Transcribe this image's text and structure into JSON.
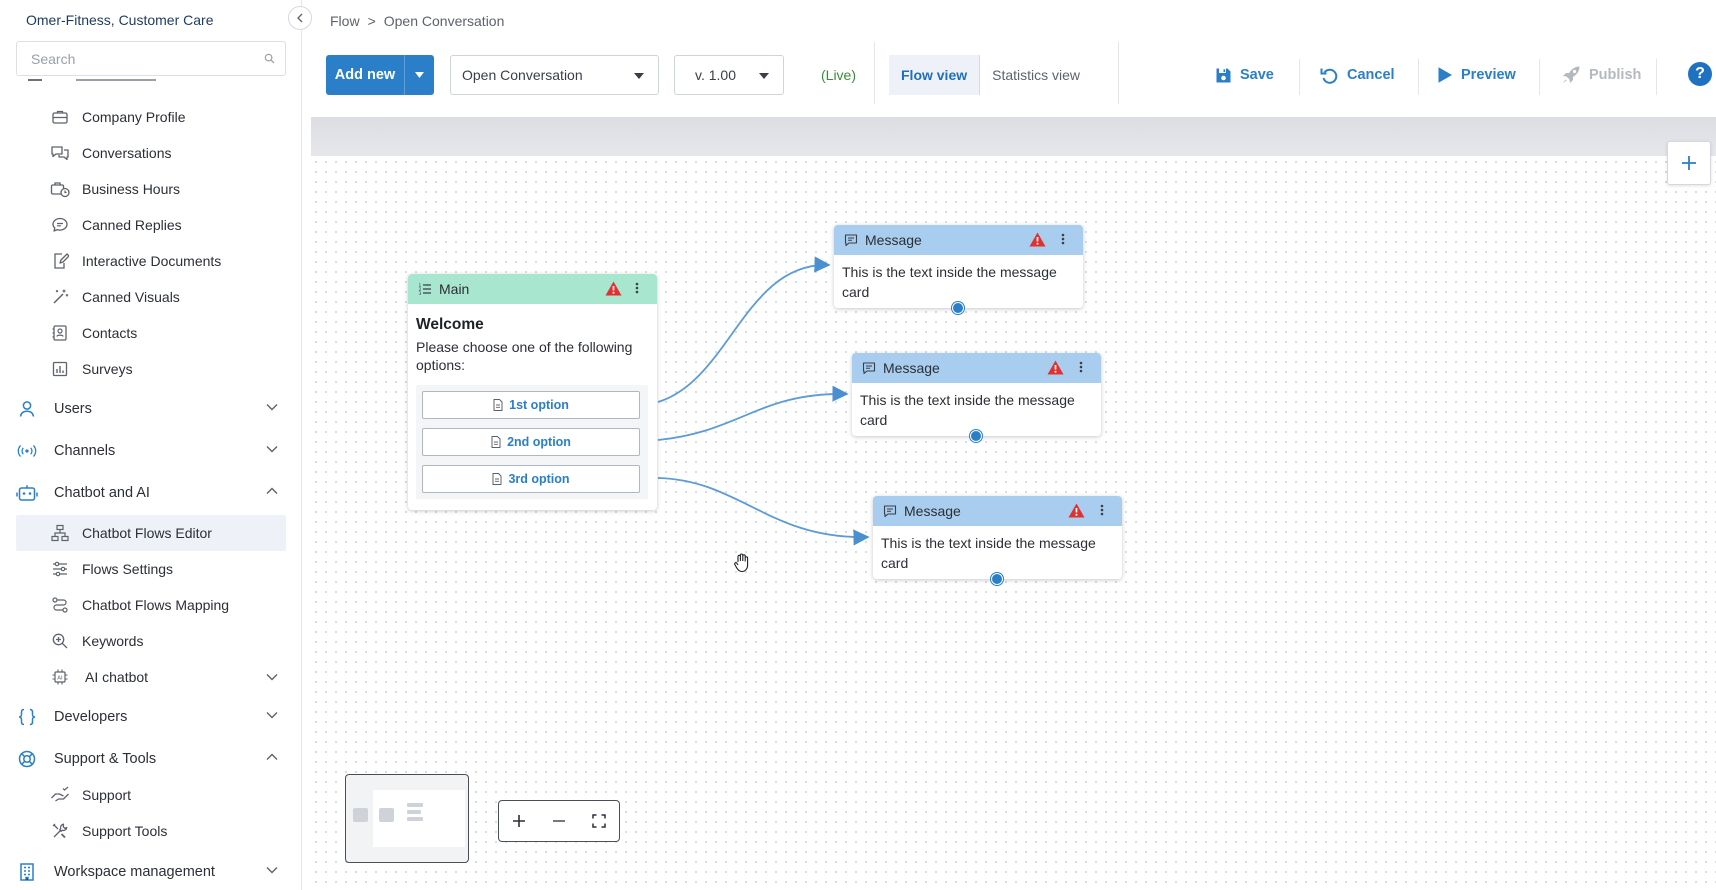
{
  "org_name": "Omer-Fitness, Customer Care",
  "search": {
    "placeholder": "Search"
  },
  "sidebar": {
    "top_items": [
      {
        "label": "Company Profile",
        "icon": "briefcase-icon"
      },
      {
        "label": "Conversations",
        "icon": "chat-bubbles-icon"
      },
      {
        "label": "Business Hours",
        "icon": "clock-briefcase-icon"
      },
      {
        "label": "Canned Replies",
        "icon": "chat-icon"
      },
      {
        "label": "Interactive Documents",
        "icon": "document-edit-icon"
      },
      {
        "label": "Canned Visuals",
        "icon": "magic-wand-icon"
      },
      {
        "label": "Contacts",
        "icon": "contact-card-icon"
      },
      {
        "label": "Surveys",
        "icon": "bar-chart-icon"
      }
    ],
    "users": "Users",
    "channels": "Channels",
    "chatbot_ai": "Chatbot and AI",
    "chatbot_items": [
      {
        "label": "Chatbot Flows Editor",
        "icon": "flow-tree-icon",
        "active": true
      },
      {
        "label": "Flows Settings",
        "icon": "sliders-icon"
      },
      {
        "label": "Chatbot Flows Mapping",
        "icon": "routing-icon"
      },
      {
        "label": "Keywords",
        "icon": "search-plus-icon"
      },
      {
        "label": "AI chatbot",
        "icon": "ai-chip-icon"
      }
    ],
    "developers": "Developers",
    "support_tools": "Support & Tools",
    "support_items": [
      {
        "label": "Support",
        "icon": "support-hand-icon"
      },
      {
        "label": "Support Tools",
        "icon": "tools-icon"
      }
    ],
    "workspace": "Workspace management"
  },
  "breadcrumb": {
    "root": "Flow",
    "separator": ">",
    "current": "Open Conversation"
  },
  "toolbar": {
    "add_new": "Add new",
    "flow_select": "Open Conversation",
    "version": "v. 1.00",
    "live": "(Live)",
    "flow_view": "Flow view",
    "statistics_view": "Statistics view",
    "save": "Save",
    "cancel": "Cancel",
    "preview": "Preview",
    "publish": "Publish",
    "help": "?"
  },
  "main_card": {
    "header": "Main",
    "title": "Welcome",
    "text": "Please choose one of the following options:",
    "options": [
      "1st option",
      "2nd option",
      "3rd option"
    ]
  },
  "message_cards": [
    {
      "header": "Message",
      "text": "This is the text inside the message card"
    },
    {
      "header": "Message",
      "text": "This is the text inside the message card"
    },
    {
      "header": "Message",
      "text": "This is the text inside the message card"
    }
  ],
  "colors": {
    "primary": "#2a7fc8",
    "main_header": "#a9e6cf",
    "message_header": "#a8cdee",
    "warning": "#e03131",
    "live": "#3d8b3d"
  }
}
